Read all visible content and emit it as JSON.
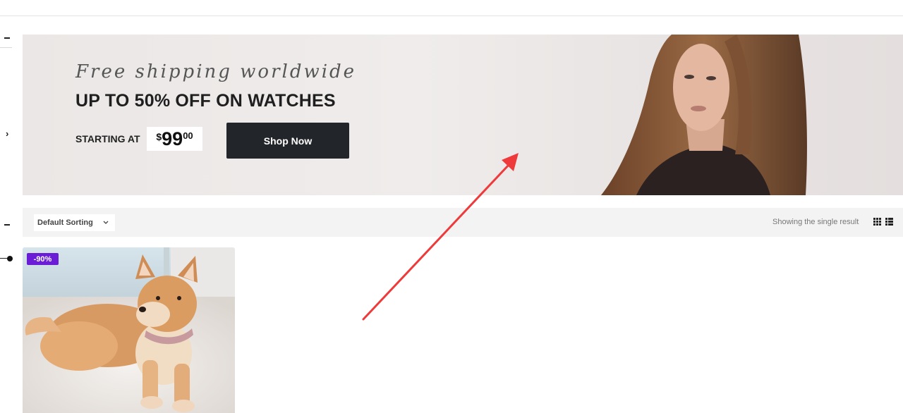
{
  "banner": {
    "tagline": "Free shipping worldwide",
    "headline": "UP TO 50% OFF ON WATCHES",
    "starting_label": "STARTING AT",
    "price": {
      "currency": "$",
      "main": "99",
      "cents": "00"
    },
    "cta_label": "Shop Now"
  },
  "toolbar": {
    "sort_selected": "Default Sorting",
    "result_count": "Showing the single result",
    "view_modes": [
      "grid-icon",
      "list-icon"
    ]
  },
  "products": [
    {
      "badge": "-90%",
      "image": "shiba-inu-dog-photo"
    }
  ],
  "colors": {
    "accent_badge": "#6a1cd6",
    "button_dark": "#222529",
    "annotation_arrow": "#ee3a3a"
  }
}
